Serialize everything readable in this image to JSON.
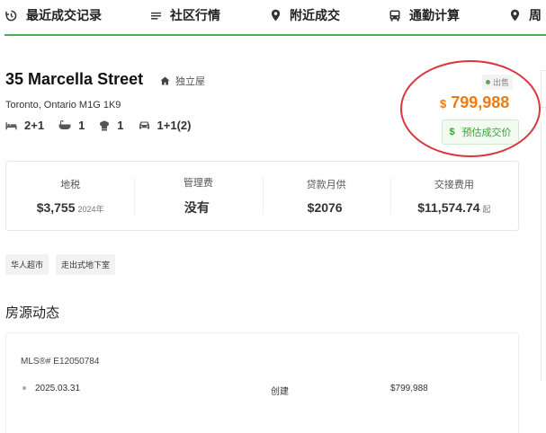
{
  "nav": {
    "items": [
      {
        "label": "最近成交记录",
        "icon": "history-icon"
      },
      {
        "label": "社区行情",
        "icon": "list-icon"
      },
      {
        "label": "附近成交",
        "icon": "location-pin-icon"
      },
      {
        "label": "通勤计算",
        "icon": "bus-icon"
      },
      {
        "label": "周",
        "icon": "location-pin-icon"
      }
    ],
    "accent_color": "#4caf50"
  },
  "listing": {
    "title": "35 Marcella Street",
    "property_type": "独立屋",
    "address": "Toronto, Ontario M1G 1K9",
    "bedrooms": "2+1",
    "bathrooms": "1",
    "kitchens": "1",
    "parking": "1+1(2)"
  },
  "pricing": {
    "status": "出售",
    "currency": "$",
    "price": "799,988",
    "estimate_button": "预估成交价",
    "estimate_icon": "$",
    "price_color": "#f07b13"
  },
  "stats": [
    {
      "label": "地税",
      "value": "$3,755",
      "sub": "2024年"
    },
    {
      "label": "管理费",
      "value": "没有",
      "sub": ""
    },
    {
      "label": "贷款月供",
      "value": "$2076",
      "sub": ""
    },
    {
      "label": "交接费用",
      "value": "$11,574.74",
      "sub": "起"
    }
  ],
  "tags": [
    "华人超市",
    "走出式地下室"
  ],
  "history": {
    "section_title": "房源动态",
    "mls": "MLS®# E12050784",
    "rows": [
      {
        "date": "2025.03.31",
        "event": "创建",
        "price": "$799,988"
      }
    ]
  }
}
